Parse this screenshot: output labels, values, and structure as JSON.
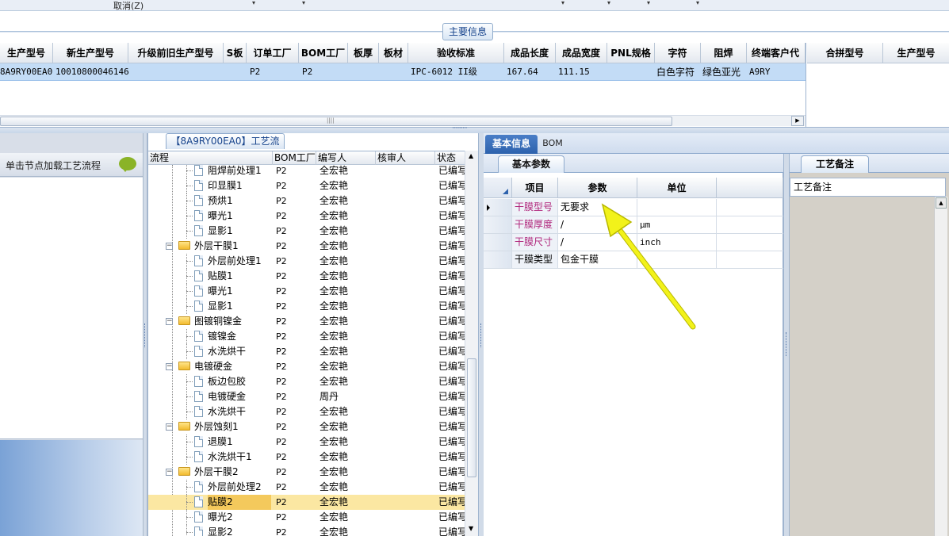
{
  "toolbar": {
    "cancel_label": "取消(Z)",
    "dropdown_glyph": "▾"
  },
  "main_info": {
    "label": "主要信息"
  },
  "grid1": {
    "columns": [
      "生产型号",
      "新生产型号",
      "升级前旧生产型号",
      "S板",
      "订单工厂",
      "BOM工厂",
      "板厚",
      "板材",
      "验收标准",
      "成品长度",
      "成品宽度",
      "PNL规格",
      "字符",
      "阻焊",
      "终端客户代"
    ],
    "row": [
      "8A9RY00EA0",
      "10010800046146",
      "",
      "",
      "P2",
      "P2",
      "",
      "",
      "IPC-6012 II级",
      "167.64",
      "111.15",
      "",
      "白色字符",
      "绿色亚光",
      "A9RY"
    ]
  },
  "grid2": {
    "columns": [
      "合拼型号",
      "生产型号"
    ]
  },
  "scroll": {
    "right_glyph": "▶",
    "up_glyph": "▲",
    "down_glyph": "▼"
  },
  "left_panel": {
    "prompt": "单击节点加载工艺流程"
  },
  "process": {
    "tab_label": "【8A9RY00EA0】工艺流程",
    "columns": [
      "流程",
      "BOM工厂",
      "编写人",
      "核审人",
      "状态"
    ],
    "rows": [
      {
        "type": "doc",
        "name": "阻焊前处理1",
        "bom": "P2",
        "writer": "全宏艳",
        "reviewer": "",
        "status": "已编写"
      },
      {
        "type": "doc",
        "name": "印显膜1",
        "bom": "P2",
        "writer": "全宏艳",
        "reviewer": "",
        "status": "已编写"
      },
      {
        "type": "doc",
        "name": "预烘1",
        "bom": "P2",
        "writer": "全宏艳",
        "reviewer": "",
        "status": "已编写"
      },
      {
        "type": "doc",
        "name": "曝光1",
        "bom": "P2",
        "writer": "全宏艳",
        "reviewer": "",
        "status": "已编写"
      },
      {
        "type": "doc",
        "name": "显影1",
        "bom": "P2",
        "writer": "全宏艳",
        "reviewer": "",
        "status": "已编写"
      },
      {
        "type": "folder",
        "name": "外层干膜1",
        "bom": "P2",
        "writer": "全宏艳",
        "reviewer": "",
        "status": "已编写"
      },
      {
        "type": "doc",
        "name": "外层前处理1",
        "bom": "P2",
        "writer": "全宏艳",
        "reviewer": "",
        "status": "已编写"
      },
      {
        "type": "doc",
        "name": "贴膜1",
        "bom": "P2",
        "writer": "全宏艳",
        "reviewer": "",
        "status": "已编写"
      },
      {
        "type": "doc",
        "name": "曝光1",
        "bom": "P2",
        "writer": "全宏艳",
        "reviewer": "",
        "status": "已编写"
      },
      {
        "type": "doc",
        "name": "显影1",
        "bom": "P2",
        "writer": "全宏艳",
        "reviewer": "",
        "status": "已编写"
      },
      {
        "type": "folder",
        "name": "图镀铜镍金",
        "bom": "P2",
        "writer": "全宏艳",
        "reviewer": "",
        "status": "已编写"
      },
      {
        "type": "doc",
        "name": "镀镍金",
        "bom": "P2",
        "writer": "全宏艳",
        "reviewer": "",
        "status": "已编写"
      },
      {
        "type": "doc",
        "name": "水洗烘干",
        "bom": "P2",
        "writer": "全宏艳",
        "reviewer": "",
        "status": "已编写"
      },
      {
        "type": "folder",
        "name": "电镀硬金",
        "bom": "P2",
        "writer": "全宏艳",
        "reviewer": "",
        "status": "已编写"
      },
      {
        "type": "doc",
        "name": "板边包胶",
        "bom": "P2",
        "writer": "全宏艳",
        "reviewer": "",
        "status": "已编写"
      },
      {
        "type": "doc",
        "name": "电镀硬金",
        "bom": "P2",
        "writer": "周丹",
        "reviewer": "",
        "status": "已编写"
      },
      {
        "type": "doc",
        "name": "水洗烘干",
        "bom": "P2",
        "writer": "全宏艳",
        "reviewer": "",
        "status": "已编写"
      },
      {
        "type": "folder",
        "name": "外层蚀刻1",
        "bom": "P2",
        "writer": "全宏艳",
        "reviewer": "",
        "status": "已编写"
      },
      {
        "type": "doc",
        "name": "退膜1",
        "bom": "P2",
        "writer": "全宏艳",
        "reviewer": "",
        "status": "已编写"
      },
      {
        "type": "doc",
        "name": "水洗烘干1",
        "bom": "P2",
        "writer": "全宏艳",
        "reviewer": "",
        "status": "已编写"
      },
      {
        "type": "folder",
        "name": "外层干膜2",
        "bom": "P2",
        "writer": "全宏艳",
        "reviewer": "",
        "status": "已编写"
      },
      {
        "type": "doc",
        "name": "外层前处理2",
        "bom": "P2",
        "writer": "全宏艳",
        "reviewer": "",
        "status": "已编写"
      },
      {
        "type": "doc",
        "name": "贴膜2",
        "bom": "P2",
        "writer": "全宏艳",
        "reviewer": "",
        "status": "已编写",
        "selected": true
      },
      {
        "type": "doc",
        "name": "曝光2",
        "bom": "P2",
        "writer": "全宏艳",
        "reviewer": "",
        "status": "已编写"
      },
      {
        "type": "doc",
        "name": "显影2",
        "bom": "P2",
        "writer": "全宏艳",
        "reviewer": "",
        "status": "已编写"
      }
    ]
  },
  "right_tabs": {
    "basic": "基本信息",
    "bom": "BOM"
  },
  "params": {
    "tab_label": "基本参数",
    "columns": [
      "项目",
      "参数",
      "单位"
    ],
    "rows": [
      {
        "item": "干膜型号",
        "param": "无要求",
        "unit": "",
        "highlight": true,
        "current": true
      },
      {
        "item": "干膜厚度",
        "param": "/",
        "unit": "μm",
        "highlight": true
      },
      {
        "item": "干膜尺寸",
        "param": "/",
        "unit": "inch",
        "highlight": true
      },
      {
        "item": "干膜类型",
        "param": "包金干膜",
        "unit": "",
        "highlight": false
      }
    ]
  },
  "notes": {
    "tab_label": "工艺备注",
    "column": "工艺备注"
  },
  "colors": {
    "accent": "#2d62ad",
    "selection": "#c3dcf6",
    "highlight_text": "#b0277c",
    "arrow": "#f2f21a"
  }
}
